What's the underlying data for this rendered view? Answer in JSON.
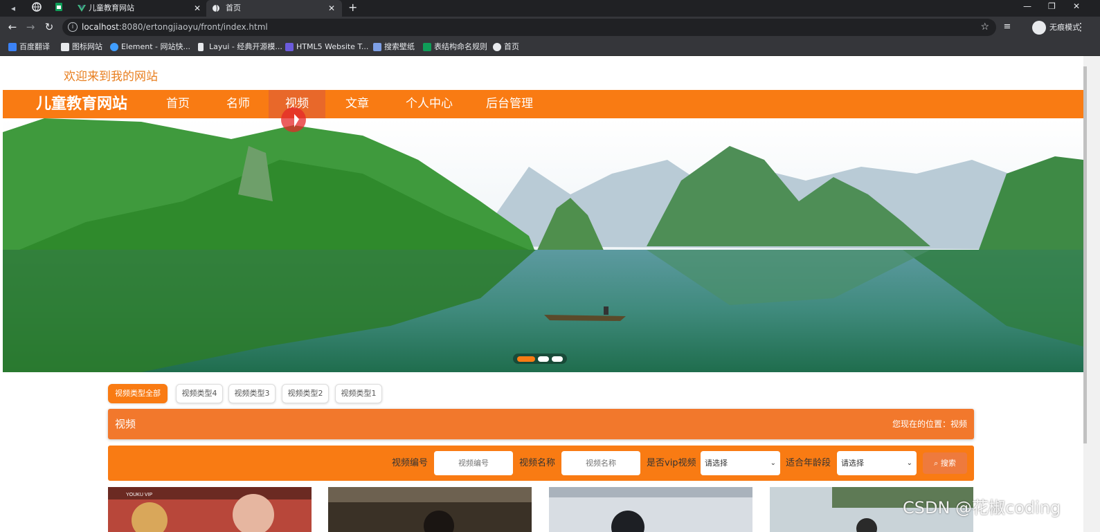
{
  "browser": {
    "tabs": [
      {
        "title": "儿童教育网站",
        "active": false
      },
      {
        "title": "首页",
        "active": true
      }
    ],
    "url_host": "localhost",
    "url_rest": ":8080/ertongjiaoyu/front/index.html",
    "incognito_label": "无痕模式",
    "bookmarks": [
      "百度翻译",
      "图标网站",
      "Element - 网站快...",
      "Layui - 经典开源模...",
      "HTML5 Website T...",
      "搜索壁纸",
      "表结构命名规则",
      "首页"
    ]
  },
  "page": {
    "welcome": "欢迎来到我的网站",
    "logo": "儿童教育网站",
    "nav": [
      "首页",
      "名师",
      "视频",
      "文章",
      "个人中心",
      "后台管理"
    ],
    "nav_active_index": 2,
    "carousel": {
      "slides": 3,
      "active_slide": 1
    },
    "chips": [
      "视频类型全部",
      "视频类型4",
      "视频类型3",
      "视频类型2",
      "视频类型1"
    ],
    "section_title": "视频",
    "location": "您现在的位置：视频",
    "search": {
      "label_no": "视频编号",
      "ph_no": "视频编号",
      "label_name": "视频名称",
      "ph_name": "视频名称",
      "label_vip": "是否vip视频",
      "vip_value": "请选择",
      "label_age": "适合年龄段",
      "age_value": "请选择",
      "button": "搜索"
    },
    "watermark": "CSDN @花椒coding",
    "card_label": "YOUKU VIP"
  },
  "colors": {
    "brand": "#f97b13",
    "title_bar": "#f2782c",
    "welcome_text": "#e87e1e"
  }
}
